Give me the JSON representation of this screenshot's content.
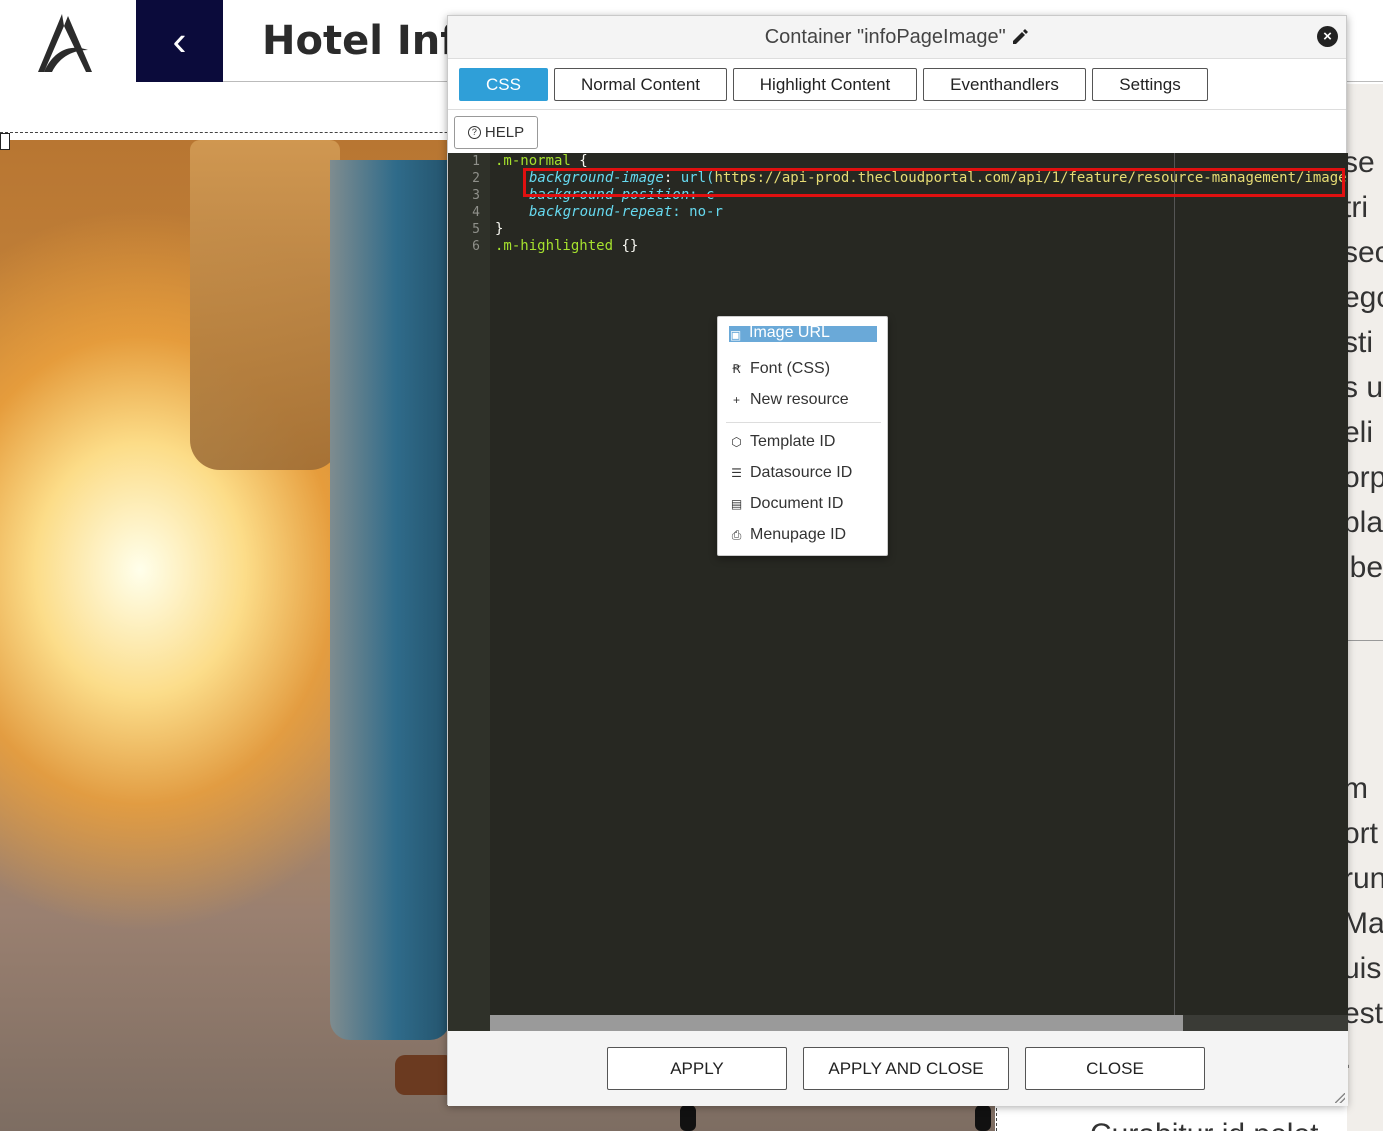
{
  "page": {
    "title": "Hotel Infor",
    "back_symbol": "‹",
    "right_column_fragments": [
      "se",
      "tri",
      "sec",
      "ego",
      "sti",
      "s u",
      "eli",
      "orp",
      "plac",
      "ibe",
      "m",
      "ort",
      "run",
      "Ma",
      "uis",
      "est",
      "."
    ],
    "bottom_fragment": "Curabitur id pelet"
  },
  "dialog": {
    "title": "Container \"infoPageImage\"",
    "close_symbol": "×",
    "tabs": [
      {
        "label": "CSS",
        "active": true
      },
      {
        "label": "Normal Content",
        "active": false
      },
      {
        "label": "Highlight Content",
        "active": false
      },
      {
        "label": "Eventhandlers",
        "active": false
      },
      {
        "label": "Settings",
        "active": false
      }
    ],
    "help_label": "HELP",
    "help_icon_symbol": "?",
    "editor": {
      "line_numbers": [
        "1",
        "2",
        "3",
        "4",
        "5",
        "6"
      ],
      "line1_selector": ".m-normal",
      "open_brace": " {",
      "line2_prop": "background-image",
      "line2_colon": ": ",
      "line2_fn": "url(",
      "line2_url": "https://api-prod.thecloudportal.com/api/1/feature/resource-management/image",
      "line3_prop": "background-position",
      "line3_val": ": c",
      "line4_prop": "background-repeat",
      "line4_val": ": no-r",
      "line5": "}",
      "line6_selector": ".m-highlighted",
      "line6_braces": " {}"
    },
    "resource_menu": {
      "items": [
        {
          "label": "Image URL",
          "icon": "image-icon",
          "glyph": "▣",
          "highlighted": true
        },
        {
          "label": "Font (CSS)",
          "icon": "font-icon",
          "glyph": "Ꞧ",
          "highlighted": false
        },
        {
          "label": "New resource",
          "icon": "plus-icon",
          "glyph": "+",
          "highlighted": false
        },
        {
          "label": "Template ID",
          "icon": "cube-icon",
          "glyph": "⬡",
          "highlighted": false
        },
        {
          "label": "Datasource ID",
          "icon": "database-icon",
          "glyph": "☰",
          "highlighted": false
        },
        {
          "label": "Document ID",
          "icon": "document-icon",
          "glyph": "▤",
          "highlighted": false
        },
        {
          "label": "Menupage ID",
          "icon": "menupage-icon",
          "glyph": "⎙",
          "highlighted": false
        }
      ]
    },
    "footer": {
      "apply_label": "APPLY",
      "apply_close_label": "APPLY AND CLOSE",
      "close_label": "CLOSE"
    }
  },
  "colors": {
    "active_tab": "#2f9fd8",
    "back_button": "#0b0b3b",
    "editor_bg": "#272822",
    "highlight_box": "#e01010",
    "menu_highlight": "#6aa9d8"
  }
}
